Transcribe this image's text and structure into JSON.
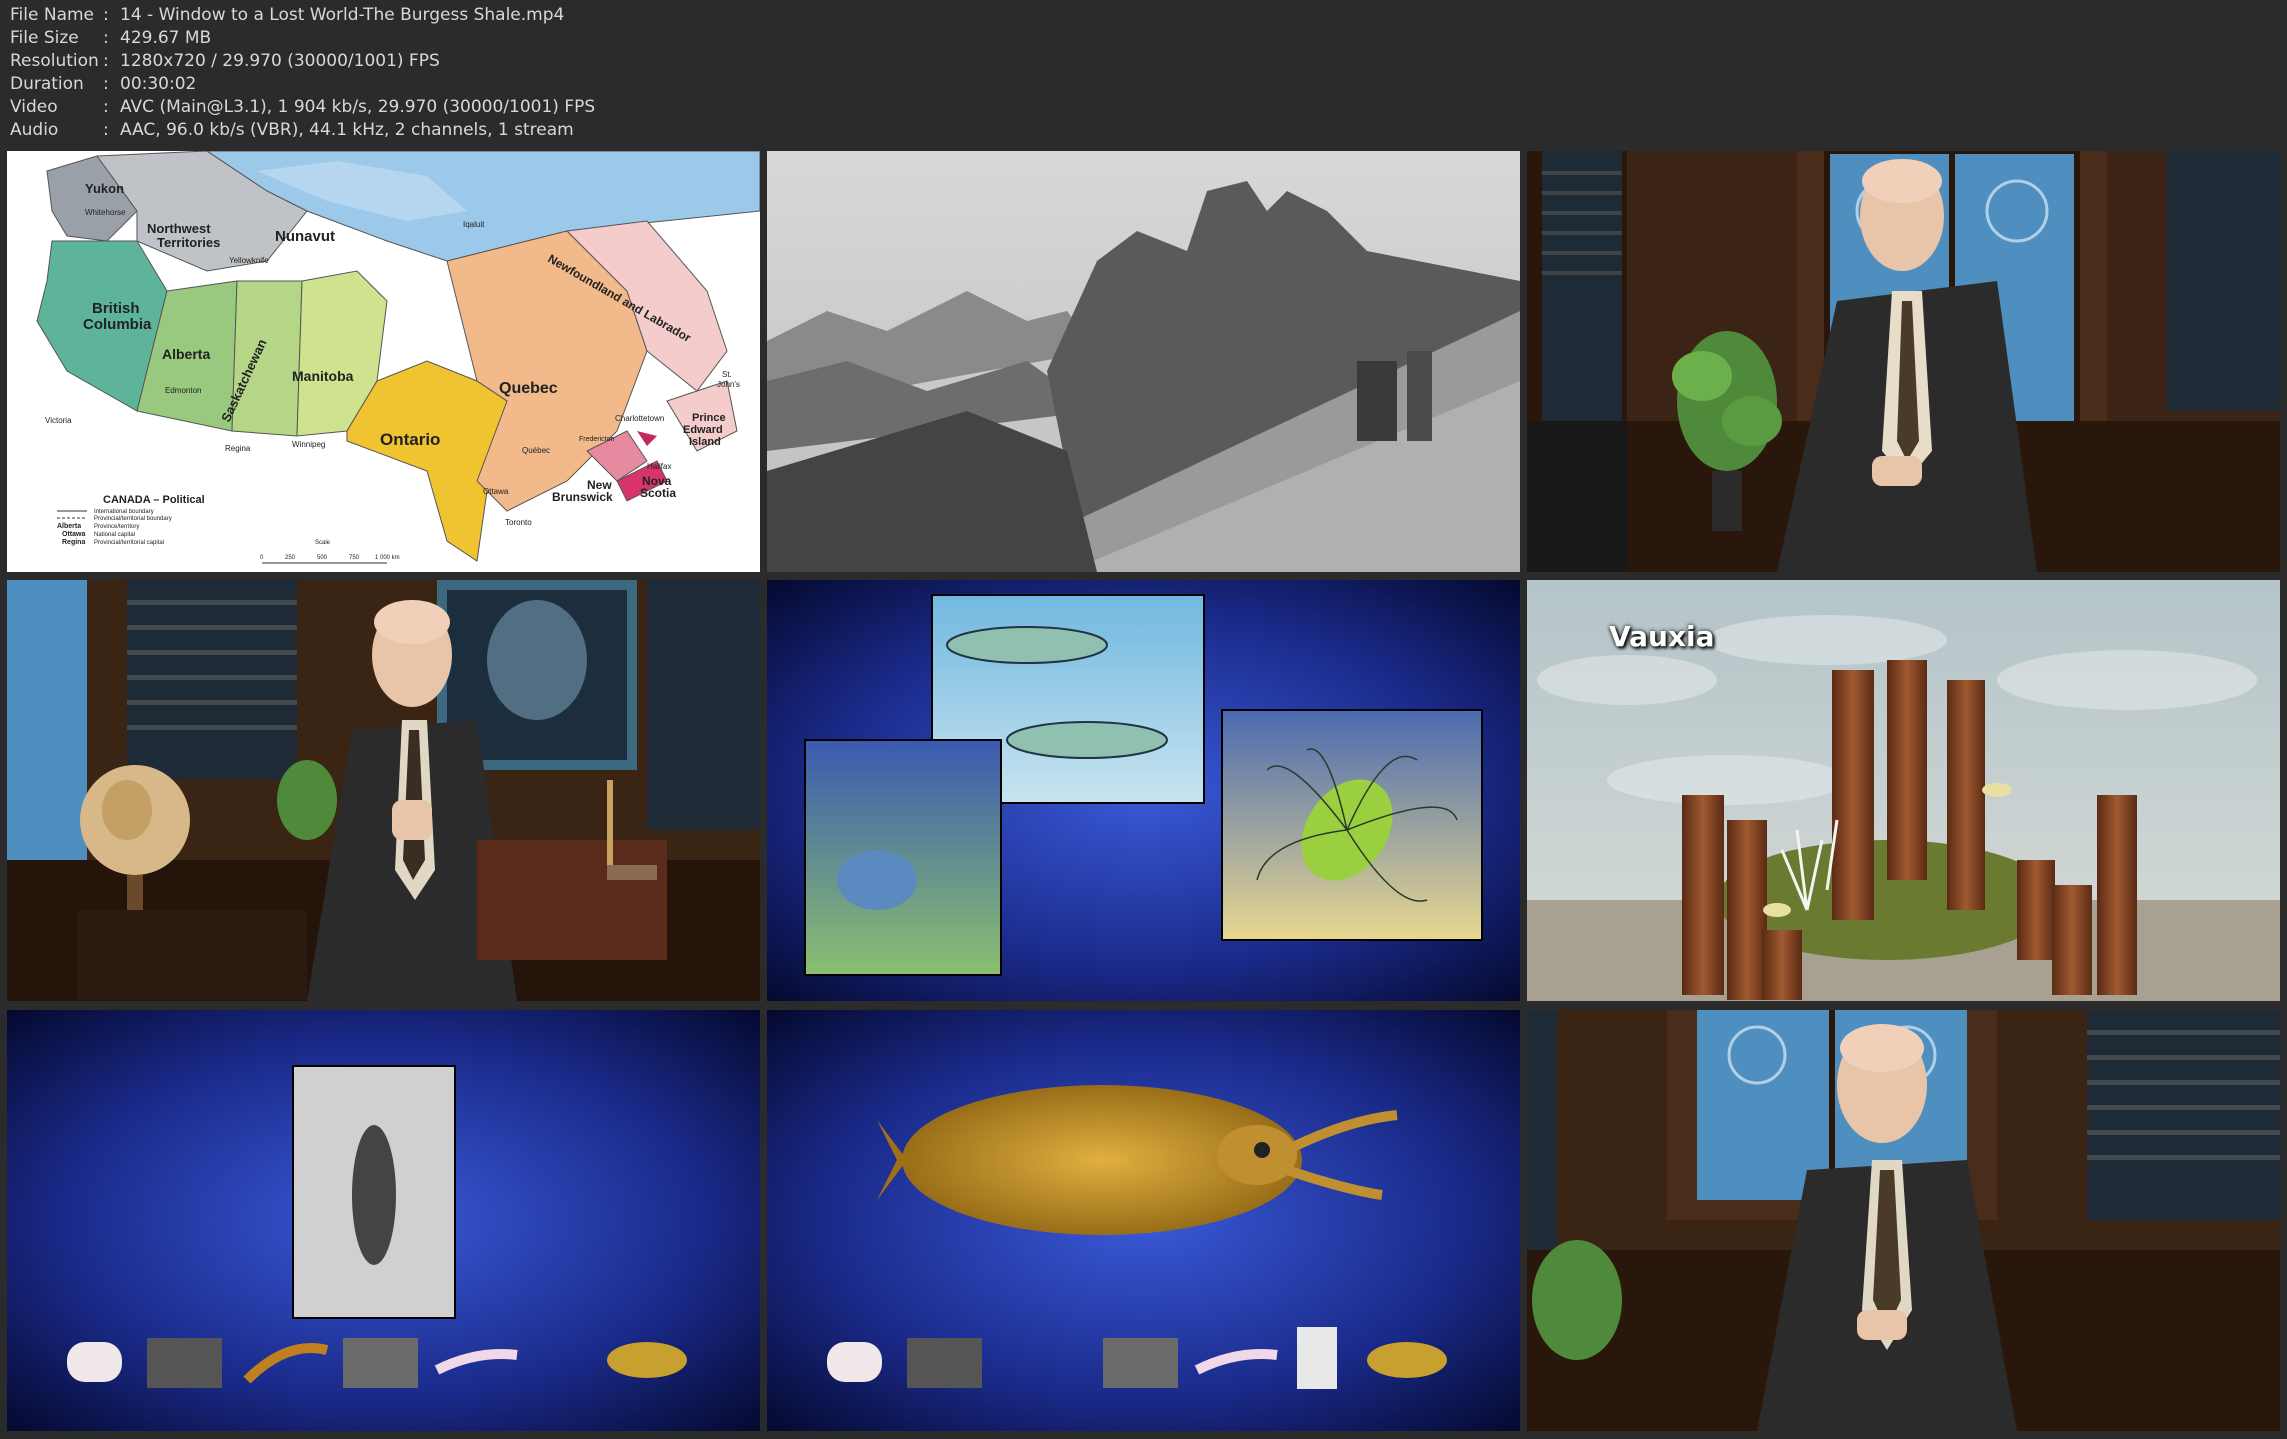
{
  "info": [
    {
      "label": "File Name",
      "value": "14 - Window to a Lost World-The Burgess Shale.mp4"
    },
    {
      "label": "File Size",
      "value": "429.67 MB"
    },
    {
      "label": "Resolution",
      "value": "1280x720 / 29.970 (30000/1001) FPS"
    },
    {
      "label": "Duration",
      "value": "00:30:02"
    },
    {
      "label": "Video",
      "value": "AVC (Main@L3.1), 1 904 kb/s, 29.970 (30000/1001) FPS"
    },
    {
      "label": "Audio",
      "value": "AAC, 96.0 kb/s (VBR), 44.1 kHz, 2 channels, 1 stream"
    }
  ],
  "separator": ":",
  "map": {
    "yukon": "Yukon",
    "whitehorse": "Whitehorse",
    "nwt": "Northwest",
    "nwt2": "Territories",
    "yellowknife": "Yellowknife",
    "nunavut": "Nunavut",
    "iqaluit": "Iqaluit",
    "nfl": "Newfoundland and Labrador",
    "stjohns": "St.",
    "stjohns2": "John's",
    "bc": "British",
    "bc2": "Columbia",
    "alberta": "Alberta",
    "edmonton": "Edmonton",
    "sask": "Saskatchewan",
    "regina": "Regina",
    "manitoba": "Manitoba",
    "winnipeg": "Winnipeg",
    "ontario": "Ontario",
    "ottawa": "Ottawa",
    "toronto": "Toronto",
    "quebec": "Quebec",
    "quebec_city": "Québec",
    "victoria": "Victoria",
    "fredericton": "Fredericton",
    "charlottetown": "Charlottetown",
    "pei": "Prince",
    "pei2": "Edward",
    "pei3": "Island",
    "halifax": "Halifax",
    "ns": "Nova",
    "ns2": "Scotia",
    "nb": "New",
    "nb2": "Brunswick",
    "legend_title": "CANADA – Political",
    "legend": [
      "International boundary",
      "Provincial/territorial boundary",
      "Province/territory",
      "National capital",
      "Provincial/territorial capital"
    ],
    "legend_keys": [
      "Alberta",
      "Ottawa",
      "Regina"
    ],
    "scale_label": "Scale",
    "scale_ticks": [
      "0",
      "250",
      "500",
      "750",
      "1 000 km"
    ]
  },
  "vauxia_label": "Vauxia",
  "colors": {
    "background": "#2b2b2b",
    "text": "#d8d8d8",
    "space_blue": "#1a2a8a"
  }
}
